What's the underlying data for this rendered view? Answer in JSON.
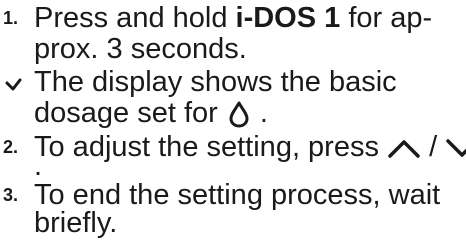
{
  "steps": [
    {
      "marker": "1.",
      "line1": {
        "pre": "Press and hold ",
        "bold": "i-DOS 1",
        "post": " for ap-"
      },
      "line2": "prox. 3 seconds."
    },
    {
      "marker_icon": "checkmark-arrow-icon",
      "line1": "The display shows the basic",
      "line2": {
        "pre": "dosage set for ",
        "icon": "water-drop-icon",
        "post": " ."
      }
    },
    {
      "marker": "2.",
      "line1": {
        "pre": "To adjust the setting, press ",
        "icon_up": "chevron-up-icon",
        "sep": " / ",
        "icon_down": "chevron-down-icon"
      },
      "line2": "."
    },
    {
      "marker": "3.",
      "line1": "To end the setting process, wait",
      "line2": "briefly."
    }
  ]
}
